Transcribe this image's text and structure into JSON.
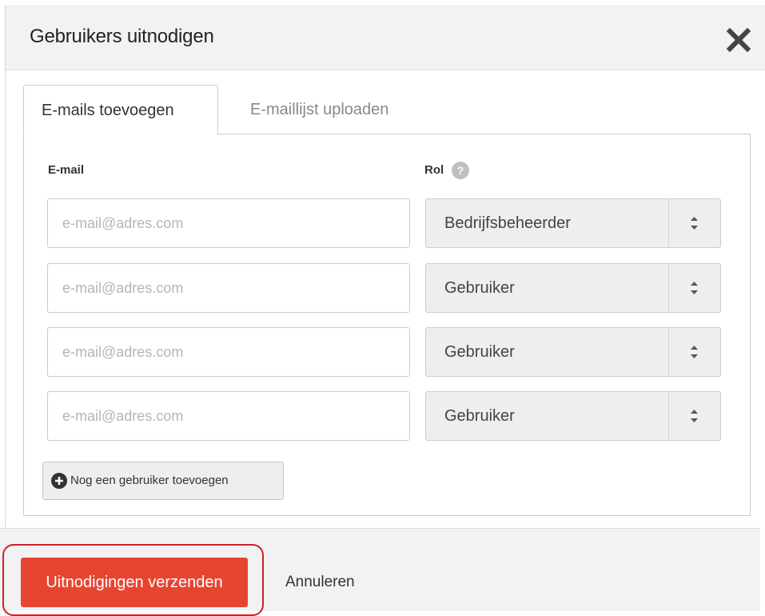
{
  "modal": {
    "title": "Gebruikers uitnodigen",
    "close_icon": "close-icon"
  },
  "tabs": [
    {
      "label": "E-mails toevoegen",
      "active": true
    },
    {
      "label": "E-maillijst uploaden",
      "active": false
    }
  ],
  "form": {
    "email_label": "E-mail",
    "role_label": "Rol",
    "help_icon": "help-icon",
    "help_glyph": "?",
    "rows": [
      {
        "email_placeholder": "e-mail@adres.com",
        "email_value": "",
        "role": "Bedrijfsbeheerder"
      },
      {
        "email_placeholder": "e-mail@adres.com",
        "email_value": "",
        "role": "Gebruiker"
      },
      {
        "email_placeholder": "e-mail@adres.com",
        "email_value": "",
        "role": "Gebruiker"
      },
      {
        "email_placeholder": "e-mail@adres.com",
        "email_value": "",
        "role": "Gebruiker"
      }
    ],
    "add_user_label": "Nog een gebruiker toevoegen",
    "add_icon": "plus-circle-icon"
  },
  "footer": {
    "send_label": "Uitnodigingen verzenden",
    "cancel_label": "Annuleren"
  },
  "colors": {
    "primary_button": "#e84531",
    "highlight_outline": "#d0202a",
    "header_background": "#f2f2f2"
  }
}
